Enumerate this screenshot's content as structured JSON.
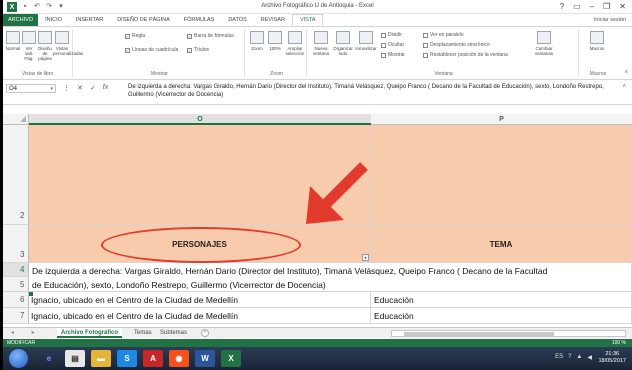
{
  "window": {
    "title": "Archivo Fotográfico U de Antioquia - Excel",
    "signin": "Iniciar sesión"
  },
  "ribbon_tabs": [
    "ARCHIVO",
    "INICIO",
    "INSERTAR",
    "DISEÑO DE PÁGINA",
    "FÓRMULAS",
    "DATOS",
    "REVISAR",
    "VISTA"
  ],
  "ribbon": {
    "groups": [
      {
        "label": "Vistas de libro",
        "buttons": [
          "Normal",
          "Ver salt. Pág.",
          "Diseño de página",
          "Vistas personalizadas"
        ]
      },
      {
        "label": "Mostrar",
        "checks": [
          {
            "text": "Regla",
            "checked": true
          },
          {
            "text": "Barra de fórmulas",
            "checked": true
          },
          {
            "text": "Líneas de cuadrícula",
            "checked": true
          },
          {
            "text": "Títulos",
            "checked": true
          }
        ]
      },
      {
        "label": "Zoom",
        "buttons": [
          "Zoom",
          "100%",
          "Ampliar selección"
        ]
      },
      {
        "label": "Ventana",
        "buttons": [
          "Nueva ventana",
          "Organizar todo",
          "Inmovilizar",
          "Dividir",
          "Ocultar",
          "Mostrar",
          "Ver en paralelo",
          "Desplazamiento sincrónico",
          "Restablecer posición de la ventana",
          "Cambiar ventanas"
        ]
      },
      {
        "label": "Macros",
        "buttons": [
          "Macros"
        ]
      }
    ]
  },
  "formula_bar": {
    "name_box": "O4",
    "content": "De izquierda a derecha: Vargas Giraldo, Hernán Dario (Director del Instituto), Timaná Velásquez, Queipo Franco ( Decano de la Facultad de Educación), sexto, Londoño Restrepo, Guillermo (Vicerrector de Docencia)"
  },
  "columns": [
    "O",
    "P"
  ],
  "rows": {
    "r2": "2",
    "r3": "3",
    "r4": "4",
    "r5": "5",
    "r6": "6",
    "r7": "7"
  },
  "cells": {
    "o3": "PERSONAJES",
    "p3": "TEMA",
    "o4_line1": "De izquierda a derecha: Vargas Giraldo, Hernán Dario (Director del Instituto), Timaná Velásquez, Queipo Franco ( Decano de la Facultad",
    "o4_line2": "de Educación), sexto, Londoño Restrepo, Guillermo (Vicerrector de Docencia)",
    "o6": "Ignacio, ubicado en el Centro de la Ciudad de Medellín",
    "p6": "Educación",
    "o7": "Ignacio, ubicado en el Centro de la Ciudad de Medellín",
    "p7": "Educación"
  },
  "sheet_tabs": [
    "Archivo Fotográfico",
    "Temas",
    "Subtemas"
  ],
  "status": {
    "mode": "MODIFICAR",
    "zoom": "100 %"
  },
  "taskbar": {
    "lang": "ES",
    "time": "21:36",
    "date": "18/05/2017"
  },
  "colors": {
    "accent": "#217346",
    "header_fill": "#f8cbad",
    "annotation": "#e23b2e"
  }
}
